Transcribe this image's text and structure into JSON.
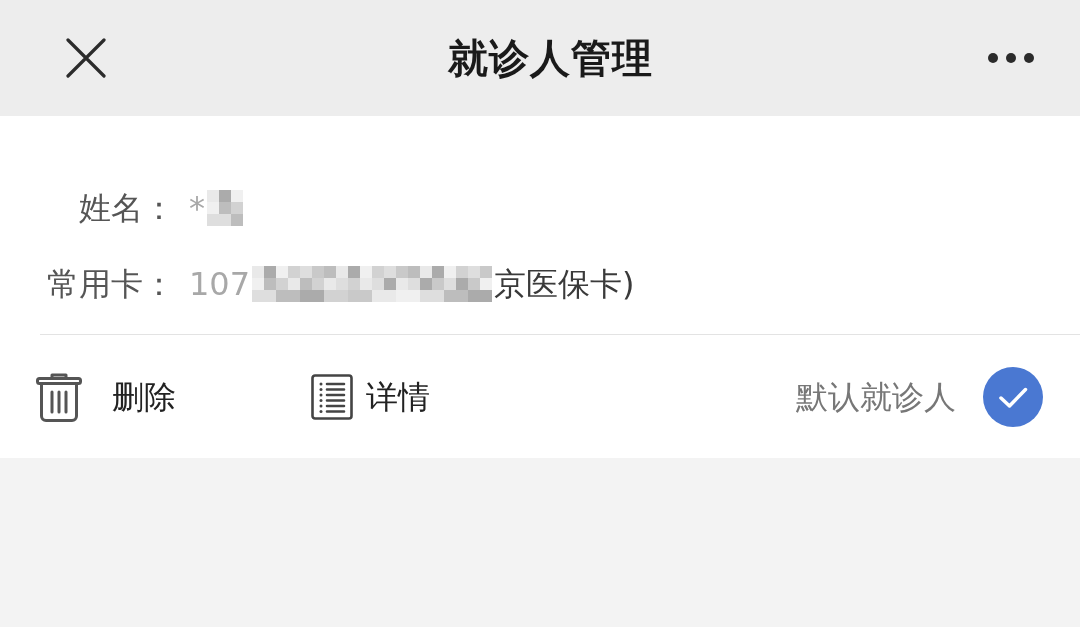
{
  "header": {
    "title": "就诊人管理"
  },
  "patient": {
    "fields": [
      {
        "label": "姓名：",
        "value": [
          {
            "kind": "blurred_text",
            "text": "*"
          },
          {
            "kind": "mosaic"
          }
        ]
      },
      {
        "label": "常用卡：",
        "value": [
          {
            "kind": "blurred_text",
            "text": "107"
          },
          {
            "kind": "mosaic"
          },
          {
            "kind": "text",
            "text": "京医保卡)"
          }
        ]
      }
    ],
    "actions": [
      {
        "kind": "delete",
        "label": "删除"
      },
      {
        "kind": "details",
        "label": "详情"
      }
    ],
    "default_patient": {
      "label": "默认就诊人",
      "checked": true
    }
  }
}
